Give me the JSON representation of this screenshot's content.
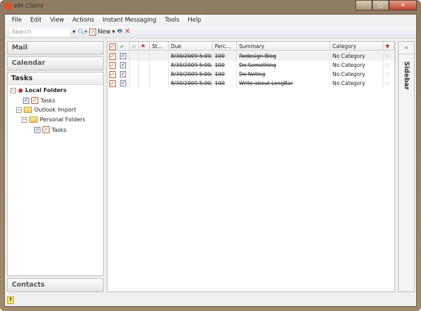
{
  "window": {
    "title": "eM Client"
  },
  "menu": [
    "File",
    "Edit",
    "View",
    "Actions",
    "Instant Messaging",
    "Tools",
    "Help"
  ],
  "toolbar": {
    "search_placeholder": "Search",
    "new_label": "New"
  },
  "nav": {
    "mail": "Mail",
    "calendar": "Calendar",
    "tasks": "Tasks",
    "contacts": "Contacts"
  },
  "tree": {
    "local_folders": "Local Folders",
    "tasks1": "Tasks",
    "outlook_import": "Outlook Import",
    "personal_folders": "Personal Folders",
    "tasks2": "Tasks"
  },
  "grid": {
    "headers": {
      "status": "St...",
      "due": "Due",
      "percent": "Perc...",
      "summary": "Summary",
      "category": "Category"
    },
    "rows": [
      {
        "due": "8/30/2009 5:00...",
        "percent": "100",
        "summary": "Redesign Blog",
        "category": "No Category"
      },
      {
        "due": "8/30/2009 5:00...",
        "percent": "100",
        "summary": "Do Something",
        "category": "No Category"
      },
      {
        "due": "8/30/2009 5:00...",
        "percent": "100",
        "summary": "Do Noting",
        "category": "No Category"
      },
      {
        "due": "8/30/2009 5:00...",
        "percent": "100",
        "summary": "Write about LongBar",
        "category": "No Category"
      }
    ]
  },
  "sidebar": {
    "collapse": "«",
    "label": "Sidebar"
  },
  "status": {
    "help": "?"
  }
}
